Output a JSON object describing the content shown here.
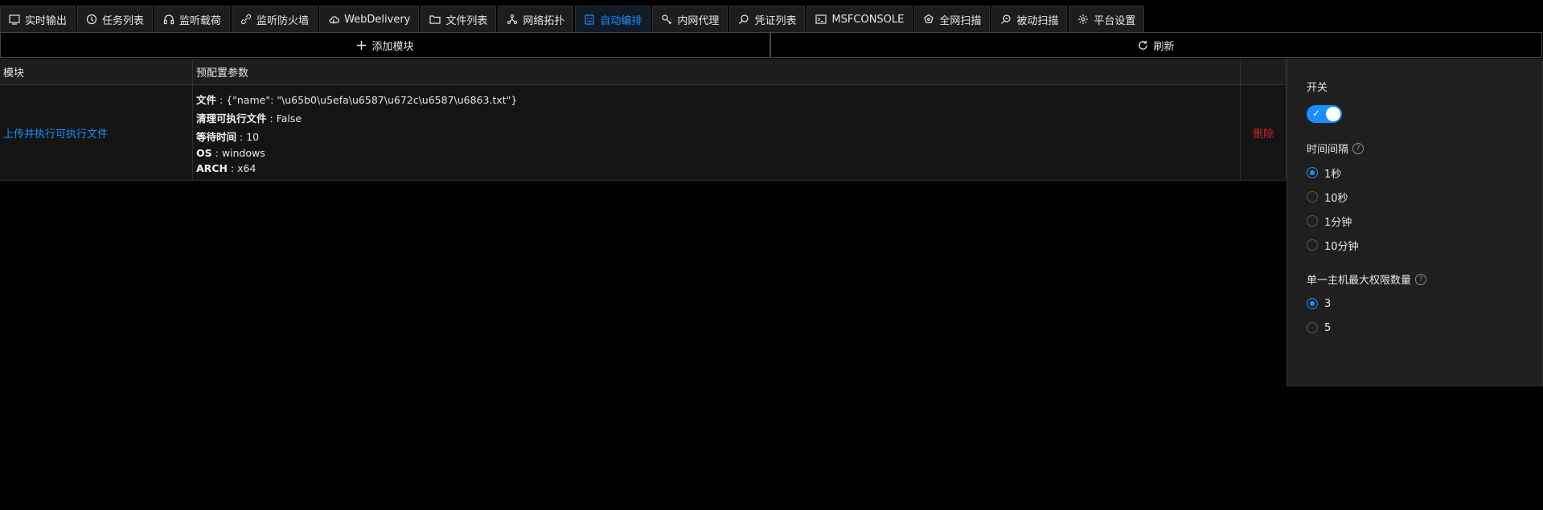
{
  "tabs": [
    {
      "label": "实时输出",
      "icon": "monitor-icon"
    },
    {
      "label": "任务列表",
      "icon": "clock-icon"
    },
    {
      "label": "监听载荷",
      "icon": "headphones-icon"
    },
    {
      "label": "监听防火墙",
      "icon": "link-icon"
    },
    {
      "label": "WebDelivery",
      "icon": "cloud-icon"
    },
    {
      "label": "文件列表",
      "icon": "folder-icon"
    },
    {
      "label": "网络拓扑",
      "icon": "network-icon"
    },
    {
      "label": "自动编排",
      "icon": "robot-icon",
      "active": true
    },
    {
      "label": "内网代理",
      "icon": "proxy-icon"
    },
    {
      "label": "凭证列表",
      "icon": "search-icon"
    },
    {
      "label": "MSFCONSOLE",
      "icon": "terminal-icon"
    },
    {
      "label": "全网扫描",
      "icon": "radar-icon"
    },
    {
      "label": "被动扫描",
      "icon": "zoom-icon"
    },
    {
      "label": "平台设置",
      "icon": "gear-icon"
    }
  ],
  "toolbar": {
    "add_label": "添加模块",
    "refresh_label": "刷新"
  },
  "table": {
    "headers": [
      "模块",
      "预配置参数",
      ""
    ],
    "rows": [
      {
        "module": "上传并执行可执行文件",
        "params": [
          {
            "key": "文件",
            "value": "{\"name\": \"\\u65b0\\u5efa\\u6587\\u672c\\u6587\\u6863.txt\"}"
          },
          {
            "key": "清理可执行文件",
            "value": "False"
          },
          {
            "key": "等待时间",
            "value": "10"
          },
          {
            "key": "OS",
            "value": "windows"
          },
          {
            "key": "ARCH",
            "value": "x64"
          }
        ],
        "action": "删除"
      }
    ]
  },
  "panel": {
    "switch_label": "开关",
    "switch_on": true,
    "interval_label": "时间间隔",
    "interval_options": [
      "1秒",
      "10秒",
      "1分钟",
      "10分钟"
    ],
    "interval_selected": "1秒",
    "max_label": "单一主机最大权限数量",
    "max_options": [
      "3",
      "5"
    ],
    "max_selected": "3"
  },
  "colors": {
    "accent": "#1890ff",
    "danger": "#d32029",
    "bg": "#000000"
  }
}
